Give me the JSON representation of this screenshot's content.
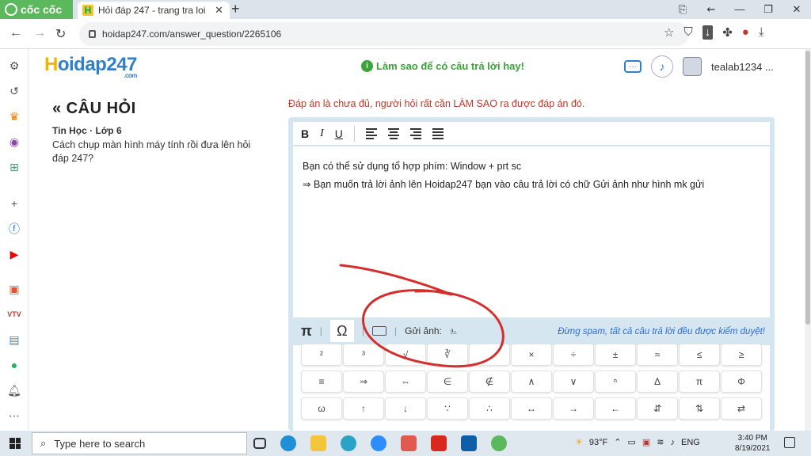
{
  "browser": {
    "brand": "cốc cốc",
    "tab_title": "Hỏi đáp 247 - trang tra loi",
    "url": "hoidap247.com/answer_question/2265106",
    "user_avatar_icon": "profile-icon"
  },
  "site": {
    "logo_h": "H",
    "logo_rest": "oidap247",
    "logo_com": ".com",
    "tip": "Làm sao để có câu trả lời hay!",
    "username": "tealab1234 ..."
  },
  "question": {
    "heading": "« CÂU HỎI",
    "subject": "Tin Học · Lớp 6",
    "text": "Cách chụp màn hình máy tính rồi đưa lên hỏi đáp 247?"
  },
  "answer": {
    "warning": "Đáp án là chưa đủ, người hỏi rất cần LÀM SAO ra được đáp án đó.",
    "line1": "Bạn có thể sử dụng tổ hợp phím: Window + prt sc",
    "line2": "⇒ Bạn muốn trả lời ảnh lên Hoidap247 bạn vào câu trả lời có chữ Gửi ảnh như hình mk gửi",
    "toolbar": {
      "bold": "B",
      "italic": "I",
      "underline": "U"
    },
    "bottom": {
      "pi": "π",
      "omega": "Ω",
      "send_image": "Gửi ảnh:",
      "spam": "Đừng spam, tất cả câu trả lời đều được kiểm duyệt!"
    }
  },
  "keys": {
    "row1": [
      "²",
      "³",
      "√",
      "∛",
      "",
      "×",
      "÷",
      "±",
      "≈",
      "≤",
      "≥"
    ],
    "row2": [
      "≡",
      "⇒",
      "⇔",
      "∈",
      "∉",
      "∧",
      "∨",
      "ⁿ",
      "Δ",
      "π",
      "Φ"
    ],
    "row3": [
      "ω",
      "↑",
      "↓",
      "∵",
      "∴",
      "↔",
      "→",
      "←",
      "⇵",
      "⇅",
      "⇄"
    ]
  },
  "taskbar": {
    "search_placeholder": "Type here to search",
    "temp": "93°F",
    "lang": "ENG",
    "time": "3:40 PM",
    "date": "8/19/2021"
  },
  "colors": {
    "accent": "#2f80c8",
    "warning": "#c0392b",
    "tip": "#3aa33a",
    "scribble": "#d32f2f"
  }
}
